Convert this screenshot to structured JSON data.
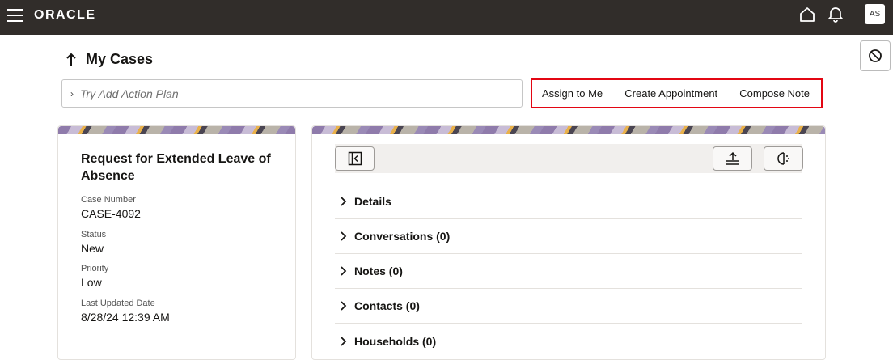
{
  "header": {
    "logo": "ORACLE",
    "avatar_initials": "AS",
    "icons": [
      "menu-icon",
      "home-icon",
      "bell-icon",
      "block-icon"
    ]
  },
  "page": {
    "title": "My Cases",
    "search_placeholder": "Try Add Action Plan"
  },
  "actions": [
    "Assign to Me",
    "Create Appointment",
    "Compose Note"
  ],
  "case": {
    "title": "Request for Extended Leave of Absence",
    "fields": [
      {
        "label": "Case Number",
        "value": "CASE-4092"
      },
      {
        "label": "Status",
        "value": "New"
      },
      {
        "label": "Priority",
        "value": "Low"
      },
      {
        "label": "Last Updated Date",
        "value": "8/28/24 12:39 AM"
      }
    ]
  },
  "sections": [
    "Details",
    "Conversations (0)",
    "Notes (0)",
    "Contacts (0)",
    "Households (0)"
  ],
  "colors": {
    "topbar": "#312d2a",
    "highlight": "#e30613"
  }
}
